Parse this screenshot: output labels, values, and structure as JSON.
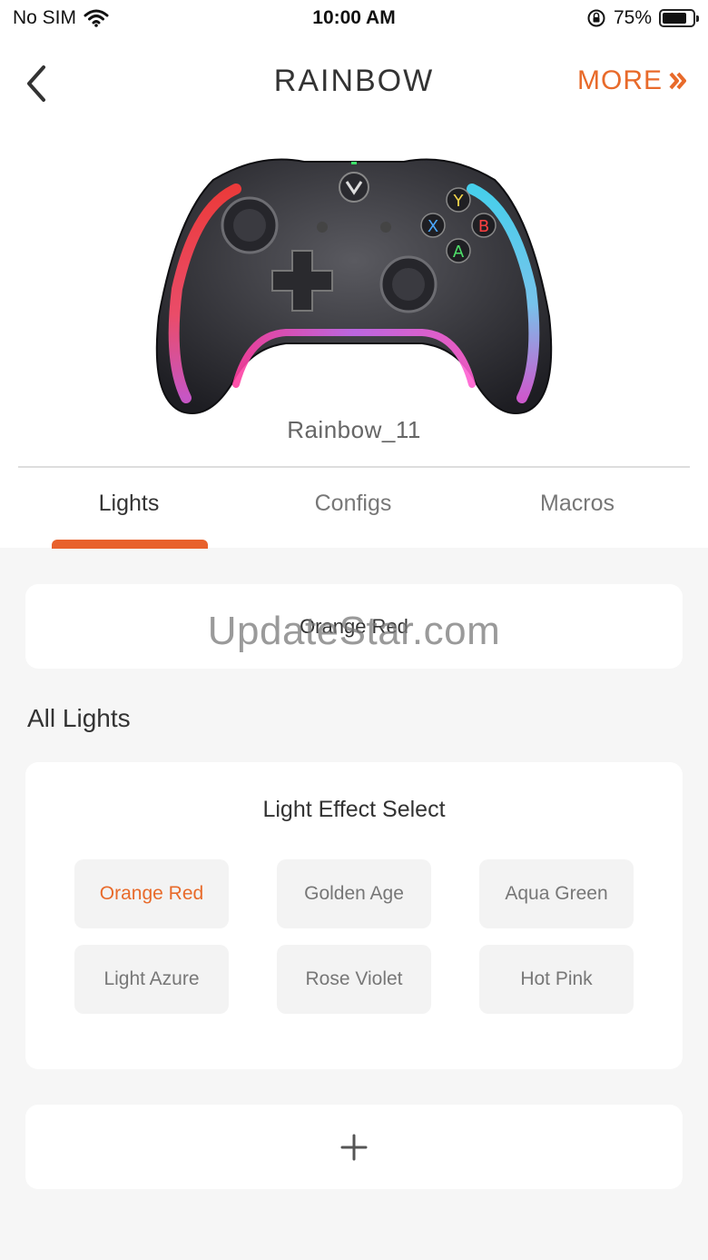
{
  "status_bar": {
    "carrier": "No SIM",
    "time": "10:00 AM",
    "battery_percent": "75%",
    "battery_level": 0.75
  },
  "nav": {
    "title": "RAINBOW",
    "more_label": "MORE"
  },
  "device": {
    "name": "Rainbow_11"
  },
  "tabs": [
    {
      "label": "Lights",
      "active": true
    },
    {
      "label": "Configs",
      "active": false
    },
    {
      "label": "Macros",
      "active": false
    }
  ],
  "current_effect": "Orange Red",
  "watermark": "UpdateStar.com",
  "section_title": "All Lights",
  "effects_card": {
    "title": "Light Effect Select",
    "options": [
      {
        "label": "Orange Red",
        "selected": true
      },
      {
        "label": "Golden Age",
        "selected": false
      },
      {
        "label": "Aqua Green",
        "selected": false
      },
      {
        "label": "Light Azure",
        "selected": false
      },
      {
        "label": "Rose Violet",
        "selected": false
      },
      {
        "label": "Hot Pink",
        "selected": false
      }
    ]
  },
  "colors": {
    "accent": "#e86a2a",
    "background": "#f6f6f6"
  }
}
